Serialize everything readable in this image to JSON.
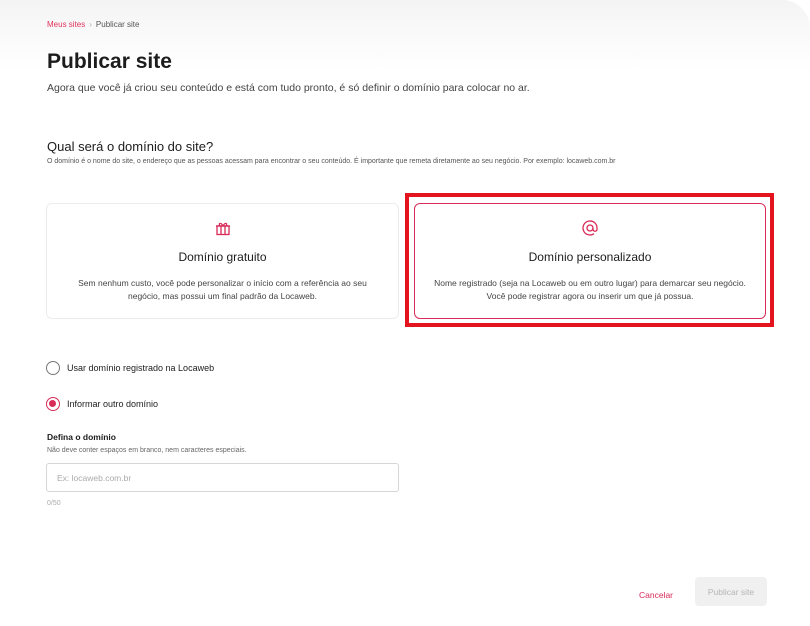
{
  "breadcrumb": {
    "parent": "Meus sites",
    "separator": "›",
    "current": "Publicar site"
  },
  "header": {
    "title": "Publicar site",
    "subtitle": "Agora que você já criou seu conteúdo e está com tudo pronto, é só definir o domínio para colocar no ar."
  },
  "domain_question": {
    "title": "Qual será o domínio do site?",
    "help": "O domínio é o nome do site, o endereço que as pessoas acessam para encontrar o seu conteúdo. É importante que remeta diretamente ao seu negócio. Por exemplo: locaweb.com.br"
  },
  "cards": {
    "free": {
      "icon": "gift-icon",
      "title": "Domínio gratuito",
      "description": "Sem nenhum custo, você pode personalizar o início com a referência ao seu negócio, mas possui um final padrão da Locaweb.",
      "selected": false
    },
    "custom": {
      "icon": "at-sign-icon",
      "title": "Domínio personalizado",
      "description": "Nome registrado (seja na Locaweb ou em outro lugar) para demarcar seu negócio. Você pode registrar agora ou inserir um que já possua.",
      "selected": true
    }
  },
  "radio_options": [
    {
      "label": "Usar domínio registrado na Locaweb",
      "checked": false
    },
    {
      "label": "Informar outro domínio",
      "checked": true
    }
  ],
  "domain_field": {
    "label": "Defina o domínio",
    "help": "Não deve conter espaços em branco, nem caracteres especiais.",
    "placeholder": "Ex: locaweb.com.br",
    "value": "",
    "counter": "0/50"
  },
  "actions": {
    "cancel": "Cancelar",
    "publish": "Publicar site"
  },
  "colors": {
    "accent": "#d92b58",
    "highlight": "#e3141d"
  }
}
